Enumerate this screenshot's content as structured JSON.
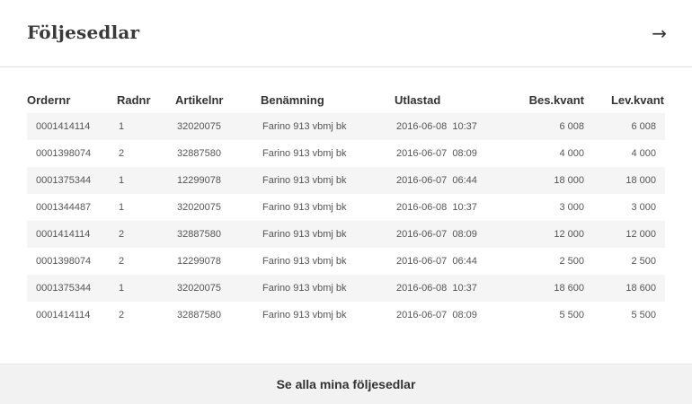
{
  "header": {
    "title": "Följesedlar",
    "arrow_glyph": "→"
  },
  "table": {
    "columns": [
      "Ordernr",
      "Radnr",
      "Artikelnr",
      "Benämning",
      "Utlastad",
      "Bes.kvant",
      "Lev.kvant"
    ],
    "rows": [
      [
        "0001414114",
        "1",
        "32020075",
        "Farino 913 vbmj bk",
        "2016-06-08  10:37",
        "6 008",
        "6 008"
      ],
      [
        "0001398074",
        "2",
        "32887580",
        "Farino 913 vbmj bk",
        "2016-06-07  08:09",
        "4 000",
        "4 000"
      ],
      [
        "0001375344",
        "1",
        "12299078",
        "Farino 913 vbmj bk",
        "2016-06-07  06:44",
        "18 000",
        "18 000"
      ],
      [
        "0001344487",
        "1",
        "32020075",
        "Farino 913 vbmj bk",
        "2016-06-08  10:37",
        "3 000",
        "3 000"
      ],
      [
        "0001414114",
        "2",
        "32887580",
        "Farino 913 vbmj bk",
        "2016-06-07  08:09",
        "12 000",
        "12 000"
      ],
      [
        "0001398074",
        "2",
        "12299078",
        "Farino 913 vbmj bk",
        "2016-06-07  06:44",
        "2 500",
        "2 500"
      ],
      [
        "0001375344",
        "1",
        "32020075",
        "Farino 913 vbmj bk",
        "2016-06-08  10:37",
        "18 600",
        "18 600"
      ],
      [
        "0001414114",
        "2",
        "32887580",
        "Farino 913 vbmj bk",
        "2016-06-07  08:09",
        "5 500",
        "5 500"
      ]
    ]
  },
  "footer": {
    "link_label": "Se alla mina följesedlar"
  }
}
